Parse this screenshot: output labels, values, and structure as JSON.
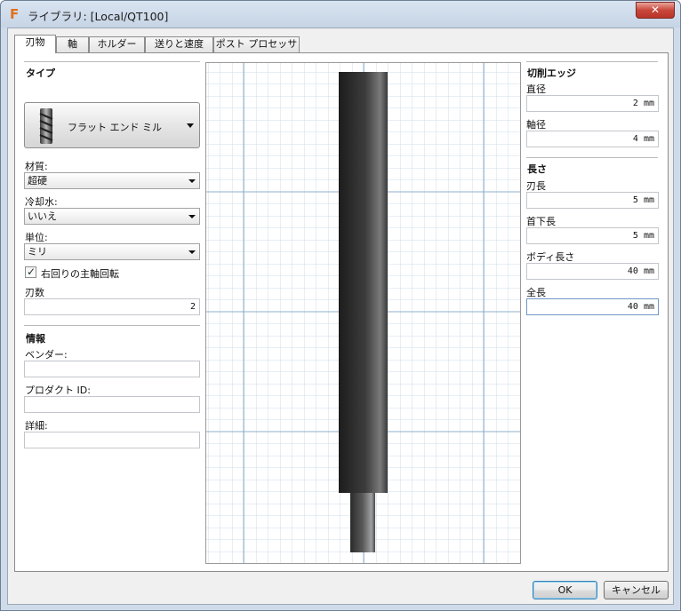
{
  "window": {
    "title": "ライブラリ: [Local/QT100]",
    "close_label": "✕"
  },
  "tabs": [
    "刃物",
    "軸",
    "ホルダー",
    "送りと速度",
    "ポスト プロセッサ"
  ],
  "left": {
    "type_section": "タイプ",
    "tool_type": "フラット エンド ミル",
    "material_label": "材質:",
    "material_value": "超硬",
    "coolant_label": "冷却水:",
    "coolant_value": "いいえ",
    "unit_label": "単位:",
    "unit_value": "ミリ",
    "clockwise_label": "右回りの主軸回転",
    "clockwise_checked": true,
    "flutes_label": "刃数",
    "flutes_value": "2",
    "info_section": "情報",
    "vendor_label": "ベンダー:",
    "vendor_value": "",
    "product_id_label": "プロダクト ID:",
    "product_id_value": "",
    "description_label": "詳細:",
    "description_value": ""
  },
  "right": {
    "cutting_edge_section": "切削エッジ",
    "diameter_label": "直径",
    "diameter_value": "2 mm",
    "shank_diameter_label": "軸径",
    "shank_diameter_value": "4 mm",
    "length_section": "長さ",
    "flute_length_label": "刃長",
    "flute_length_value": "5 mm",
    "shoulder_length_label": "首下長",
    "shoulder_length_value": "5 mm",
    "body_length_label": "ボディ長さ",
    "body_length_value": "40 mm",
    "overall_length_label": "全長",
    "overall_length_value": "40 mm"
  },
  "buttons": {
    "ok": "OK",
    "cancel": "キャンセル"
  }
}
